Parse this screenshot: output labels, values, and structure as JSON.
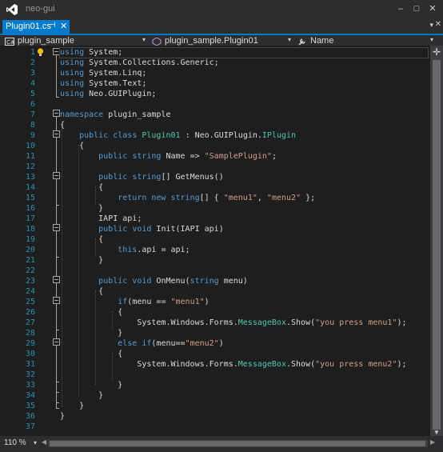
{
  "window": {
    "title": "neo-gui",
    "minimize": "–",
    "maximize": "□",
    "close": "✕"
  },
  "tabs": [
    {
      "label": "Plugin01.cs",
      "pin": "⊣",
      "close": "✕"
    }
  ],
  "tab_overflow": "▾",
  "tab_close_all": "✕",
  "nav": {
    "project": "plugin_sample",
    "type": "plugin_sample.Plugin01",
    "member": "Name"
  },
  "editor": {
    "zoom": "110 %",
    "lines": [
      [
        [
          "kw",
          "using"
        ],
        [
          "p",
          " System;"
        ]
      ],
      [
        [
          "kw",
          "using"
        ],
        [
          "p",
          " System.Collections.Generic;"
        ]
      ],
      [
        [
          "kw",
          "using"
        ],
        [
          "p",
          " System.Linq;"
        ]
      ],
      [
        [
          "kw",
          "using"
        ],
        [
          "p",
          " System.Text;"
        ]
      ],
      [
        [
          "kw",
          "using"
        ],
        [
          "p",
          " Neo.GUIPlugin;"
        ]
      ],
      [],
      [
        [
          "kw",
          "namespace"
        ],
        [
          "p",
          " plugin_sample"
        ]
      ],
      [
        [
          "p",
          "{"
        ]
      ],
      [
        [
          "p",
          "    "
        ],
        [
          "kw",
          "public class"
        ],
        [
          "p",
          " "
        ],
        [
          "ty",
          "Plugin01"
        ],
        [
          "p",
          " : Neo.GUIPlugin."
        ],
        [
          "ty",
          "IPlugin"
        ]
      ],
      [
        [
          "p",
          "    {"
        ]
      ],
      [
        [
          "p",
          "        "
        ],
        [
          "kw",
          "public string"
        ],
        [
          "p",
          " Name => "
        ],
        [
          "st",
          "\"SamplePlugin\""
        ],
        [
          "p",
          ";"
        ]
      ],
      [],
      [
        [
          "p",
          "        "
        ],
        [
          "kw",
          "public string"
        ],
        [
          "p",
          "[] GetMenus()"
        ]
      ],
      [
        [
          "p",
          "        {"
        ]
      ],
      [
        [
          "p",
          "            "
        ],
        [
          "kw",
          "return new string"
        ],
        [
          "p",
          "[] { "
        ],
        [
          "st",
          "\"menu1\""
        ],
        [
          "p",
          ", "
        ],
        [
          "st",
          "\"menu2\""
        ],
        [
          "p",
          " };"
        ]
      ],
      [
        [
          "p",
          "        }"
        ]
      ],
      [
        [
          "p",
          "        IAPI api;"
        ]
      ],
      [
        [
          "p",
          "        "
        ],
        [
          "kw",
          "public void"
        ],
        [
          "p",
          " Init(IAPI api)"
        ]
      ],
      [
        [
          "p",
          "        {"
        ]
      ],
      [
        [
          "p",
          "            "
        ],
        [
          "kw",
          "this"
        ],
        [
          "p",
          ".api = api;"
        ]
      ],
      [
        [
          "p",
          "        }"
        ]
      ],
      [],
      [
        [
          "p",
          "        "
        ],
        [
          "kw",
          "public void"
        ],
        [
          "p",
          " OnMenu("
        ],
        [
          "kw",
          "string"
        ],
        [
          "p",
          " menu)"
        ]
      ],
      [
        [
          "p",
          "        {"
        ]
      ],
      [
        [
          "p",
          "            "
        ],
        [
          "kw",
          "if"
        ],
        [
          "p",
          "(menu == "
        ],
        [
          "st",
          "\"menu1\""
        ],
        [
          "p",
          ")"
        ]
      ],
      [
        [
          "p",
          "            {"
        ]
      ],
      [
        [
          "p",
          "                System.Windows.Forms."
        ],
        [
          "ty",
          "MessageBox"
        ],
        [
          "p",
          ".Show("
        ],
        [
          "st",
          "\"you press menu1\""
        ],
        [
          "p",
          ");"
        ]
      ],
      [
        [
          "p",
          "            }"
        ]
      ],
      [
        [
          "p",
          "            "
        ],
        [
          "kw",
          "else if"
        ],
        [
          "p",
          "(menu=="
        ],
        [
          "st",
          "\"menu2\""
        ],
        [
          "p",
          ")"
        ]
      ],
      [
        [
          "p",
          "            {"
        ]
      ],
      [
        [
          "p",
          "                System.Windows.Forms."
        ],
        [
          "ty",
          "MessageBox"
        ],
        [
          "p",
          ".Show("
        ],
        [
          "st",
          "\"you press menu2\""
        ],
        [
          "p",
          ");"
        ]
      ],
      [],
      [
        [
          "p",
          "            }"
        ]
      ],
      [
        [
          "p",
          "        }"
        ]
      ],
      [
        [
          "p",
          "    }"
        ]
      ],
      [
        [
          "p",
          "}"
        ]
      ],
      []
    ]
  },
  "colors": {
    "keyword": "#569cd6",
    "type": "#4ec9b0",
    "string": "#d69d85",
    "line_number": "#2b91af",
    "accent": "#007acc"
  }
}
